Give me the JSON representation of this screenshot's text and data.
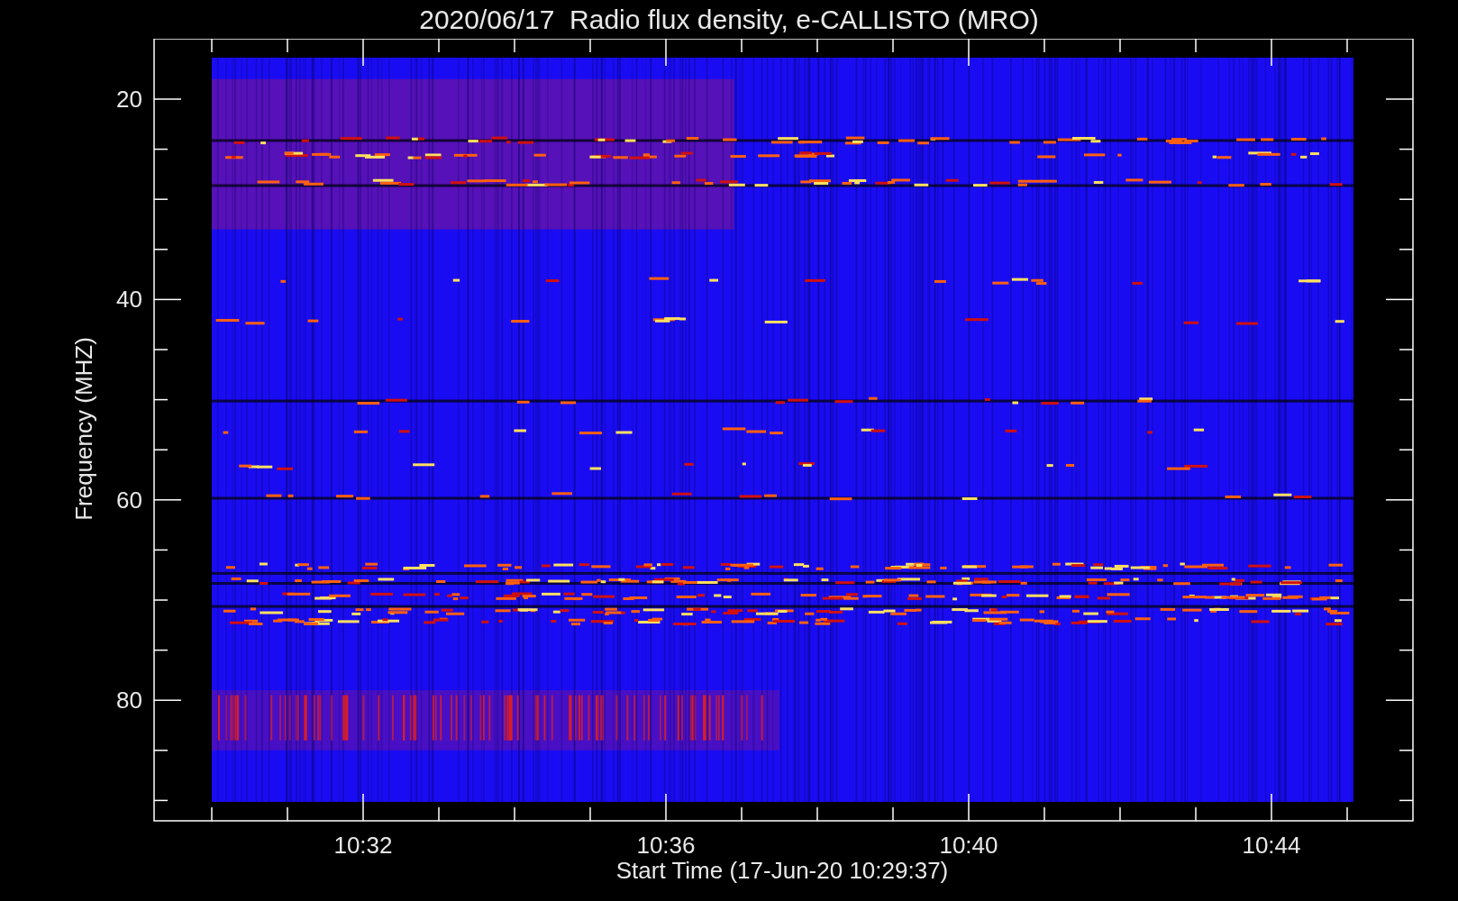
{
  "title": "2020/06/17  Radio flux density, e-CALLISTO (MRO)",
  "y_axis": {
    "label": "Frequency (MHZ)",
    "ticks": [
      "20",
      "40",
      "60",
      "80"
    ]
  },
  "x_axis": {
    "label": "Start Time (17-Jun-20 10:29:37)",
    "ticks": [
      "10:32",
      "10:36",
      "10:40",
      "10:44"
    ]
  }
}
